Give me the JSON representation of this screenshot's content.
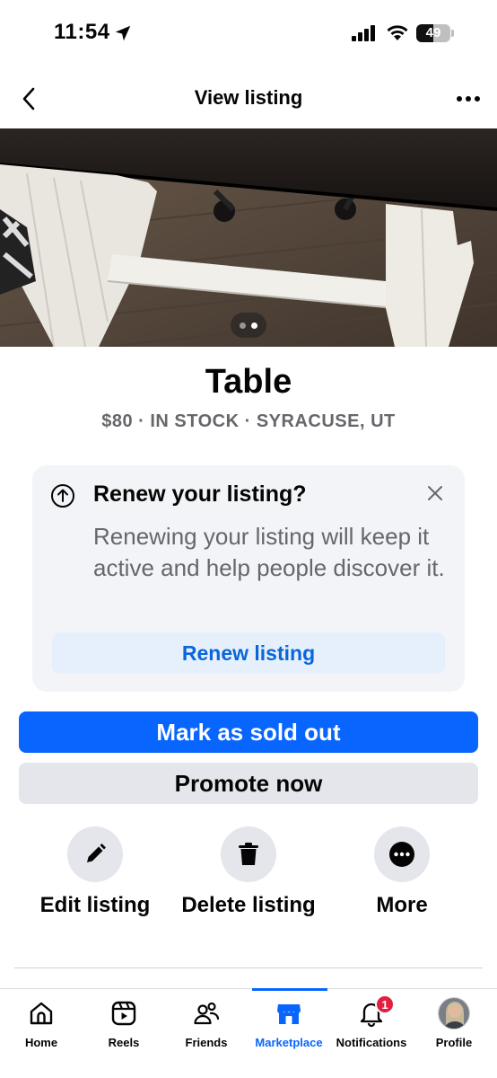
{
  "status_bar": {
    "time": "11:54",
    "battery_level": "49",
    "battery_fraction": 0.49
  },
  "header": {
    "title": "View listing",
    "back_icon": "chevron-left-icon",
    "more_icon": "more-horizontal-icon"
  },
  "photo": {
    "page_count": 2,
    "current_page": 2
  },
  "listing": {
    "title": "Table",
    "meta": "$80 · IN STOCK · SYRACUSE, UT"
  },
  "renew_card": {
    "heading": "Renew your listing?",
    "body": "Renewing your listing will keep it active and help people discover it.",
    "button_label": "Renew listing",
    "icon": "arrow-up-circle-icon",
    "close_icon": "close-icon"
  },
  "buttons": {
    "primary_label": "Mark as sold out",
    "secondary_label": "Promote now"
  },
  "actions": [
    {
      "label": "Edit listing",
      "icon": "pencil-icon"
    },
    {
      "label": "Delete listing",
      "icon": "trash-icon"
    },
    {
      "label": "More",
      "icon": "more-horizontal-icon"
    }
  ],
  "tabs": [
    {
      "label": "Home",
      "icon": "home-icon"
    },
    {
      "label": "Reels",
      "icon": "reels-icon"
    },
    {
      "label": "Friends",
      "icon": "friends-icon"
    },
    {
      "label": "Marketplace",
      "icon": "marketplace-icon",
      "active": true
    },
    {
      "label": "Notifications",
      "icon": "bell-icon",
      "badge": "1"
    },
    {
      "label": "Profile",
      "icon": "avatar"
    }
  ],
  "colors": {
    "accent": "#0866ff",
    "renew_link": "#0a66d9",
    "badge": "#e41e3f",
    "muted_text": "#65676b"
  }
}
